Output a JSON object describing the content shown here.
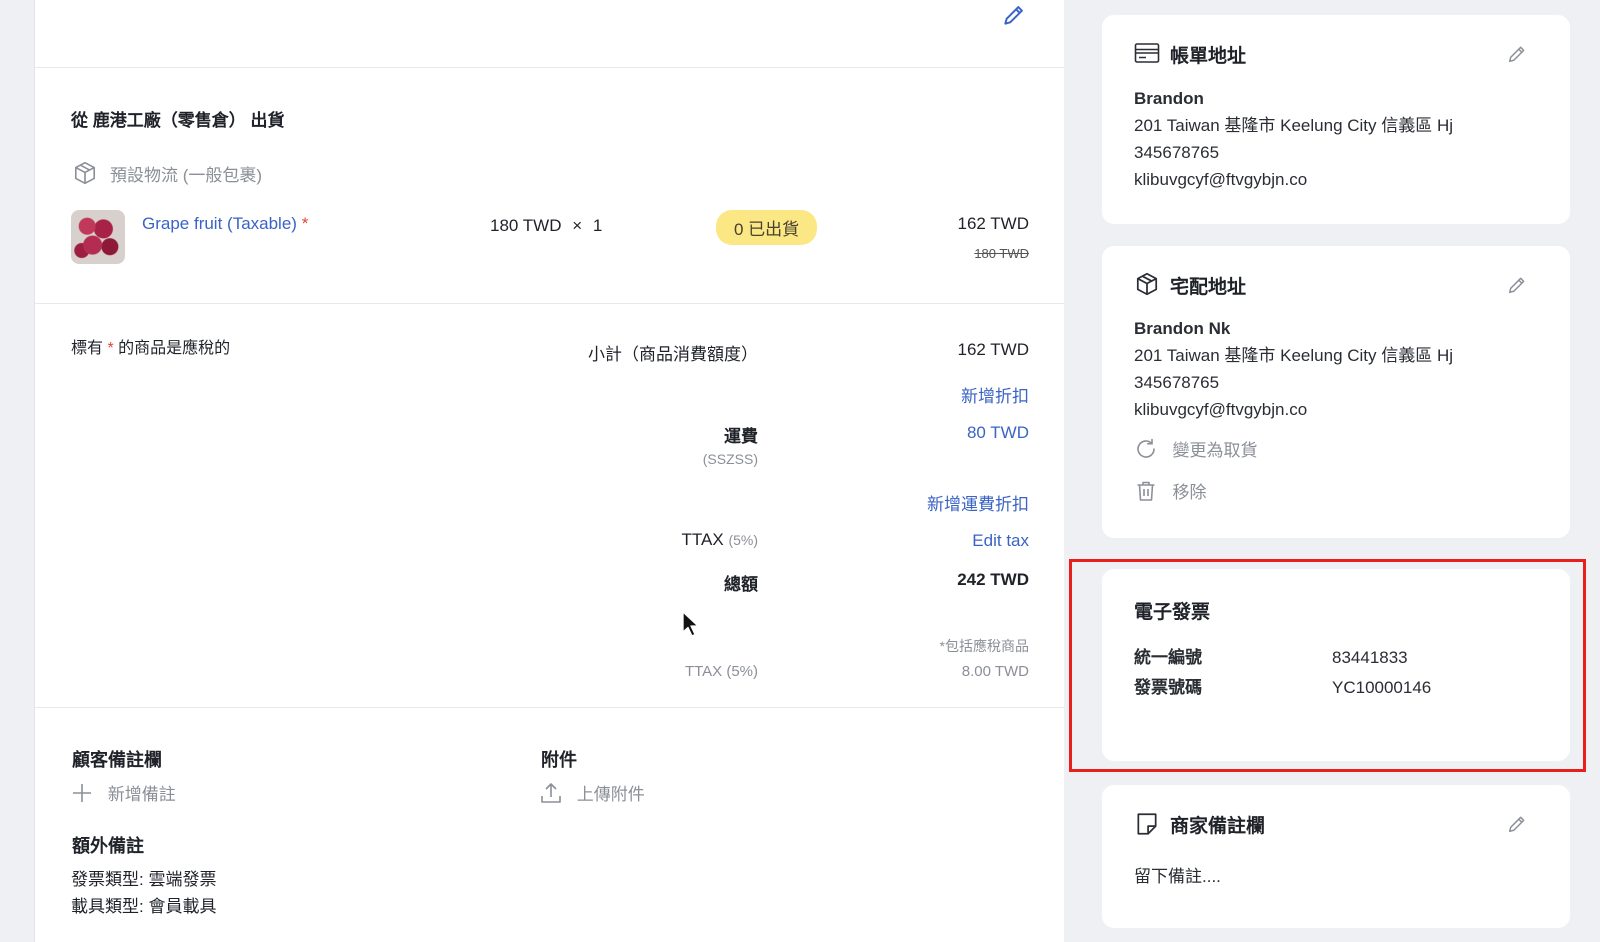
{
  "shipment": {
    "from_label": "從 鹿港工廠（零售倉） 出貨",
    "logistics_label": "預設物流 (一般包裹)",
    "item": {
      "name": "Grape fruit (Taxable)",
      "taxable_mark": "*",
      "unit_price": "180 TWD",
      "times": "×",
      "qty": "1",
      "status_badge": "0 已出貨",
      "price": "162 TWD",
      "original_price": "180 TWD"
    }
  },
  "summary": {
    "tax_note_prefix": "標有",
    "tax_note_mark": "*",
    "tax_note_suffix": "的商品是應稅的",
    "subtotal_label": "小計（商品消費額度）",
    "subtotal_value": "162 TWD",
    "add_discount": "新增折扣",
    "shipping_label": "運費",
    "shipping_method": "(SSZSS)",
    "shipping_value": "80 TWD",
    "add_shipping_discount": "新增運費折扣",
    "tax_label": "TTAX",
    "tax_rate": "(5%)",
    "edit_tax": "Edit tax",
    "total_label": "總額",
    "total_value": "242 TWD",
    "includes_note": "*包括應稅商品",
    "tax_detail_label": "TTAX (5%)",
    "tax_detail_value": "8.00 TWD"
  },
  "notes": {
    "customer_notes_title": "顧客備註欄",
    "add_note": "新增備註",
    "attachments_title": "附件",
    "upload_attachment": "上傳附件",
    "extra_notes_title": "額外備註",
    "invoice_type": "發票類型: 雲端發票",
    "carrier_type": "載具類型: 會員載具"
  },
  "billing": {
    "title": "帳單地址",
    "name": "Brandon",
    "address": "201 Taiwan 基隆市 Keelung City 信義區 Hj",
    "phone": "345678765",
    "email": "klibuvgcyf@ftvgybjn.co"
  },
  "delivery": {
    "title": "宅配地址",
    "name": "Brandon Nk",
    "address": "201 Taiwan 基隆市 Keelung City 信義區 Hj",
    "phone": "345678765",
    "email": "klibuvgcyf@ftvgybjn.co",
    "change_to_pickup": "變更為取貨",
    "remove": "移除"
  },
  "einvoice": {
    "title": "電子發票",
    "tax_id_label": "統一編號",
    "tax_id_value": "83441833",
    "invoice_no_label": "發票號碼",
    "invoice_no_value": "YC10000146"
  },
  "merchant_notes": {
    "title": "商家備註欄",
    "placeholder": "留下備註...."
  },
  "icons": [
    "pencil-icon",
    "package-icon",
    "credit-card-icon",
    "refresh-icon",
    "trash-icon",
    "plus-icon",
    "upload-icon",
    "note-icon",
    "cursor-icon"
  ],
  "colors": {
    "link_blue": "#3a63c5",
    "badge_yellow": "#fbe885",
    "highlight_red": "#e8201d",
    "background": "#eef0f4"
  }
}
